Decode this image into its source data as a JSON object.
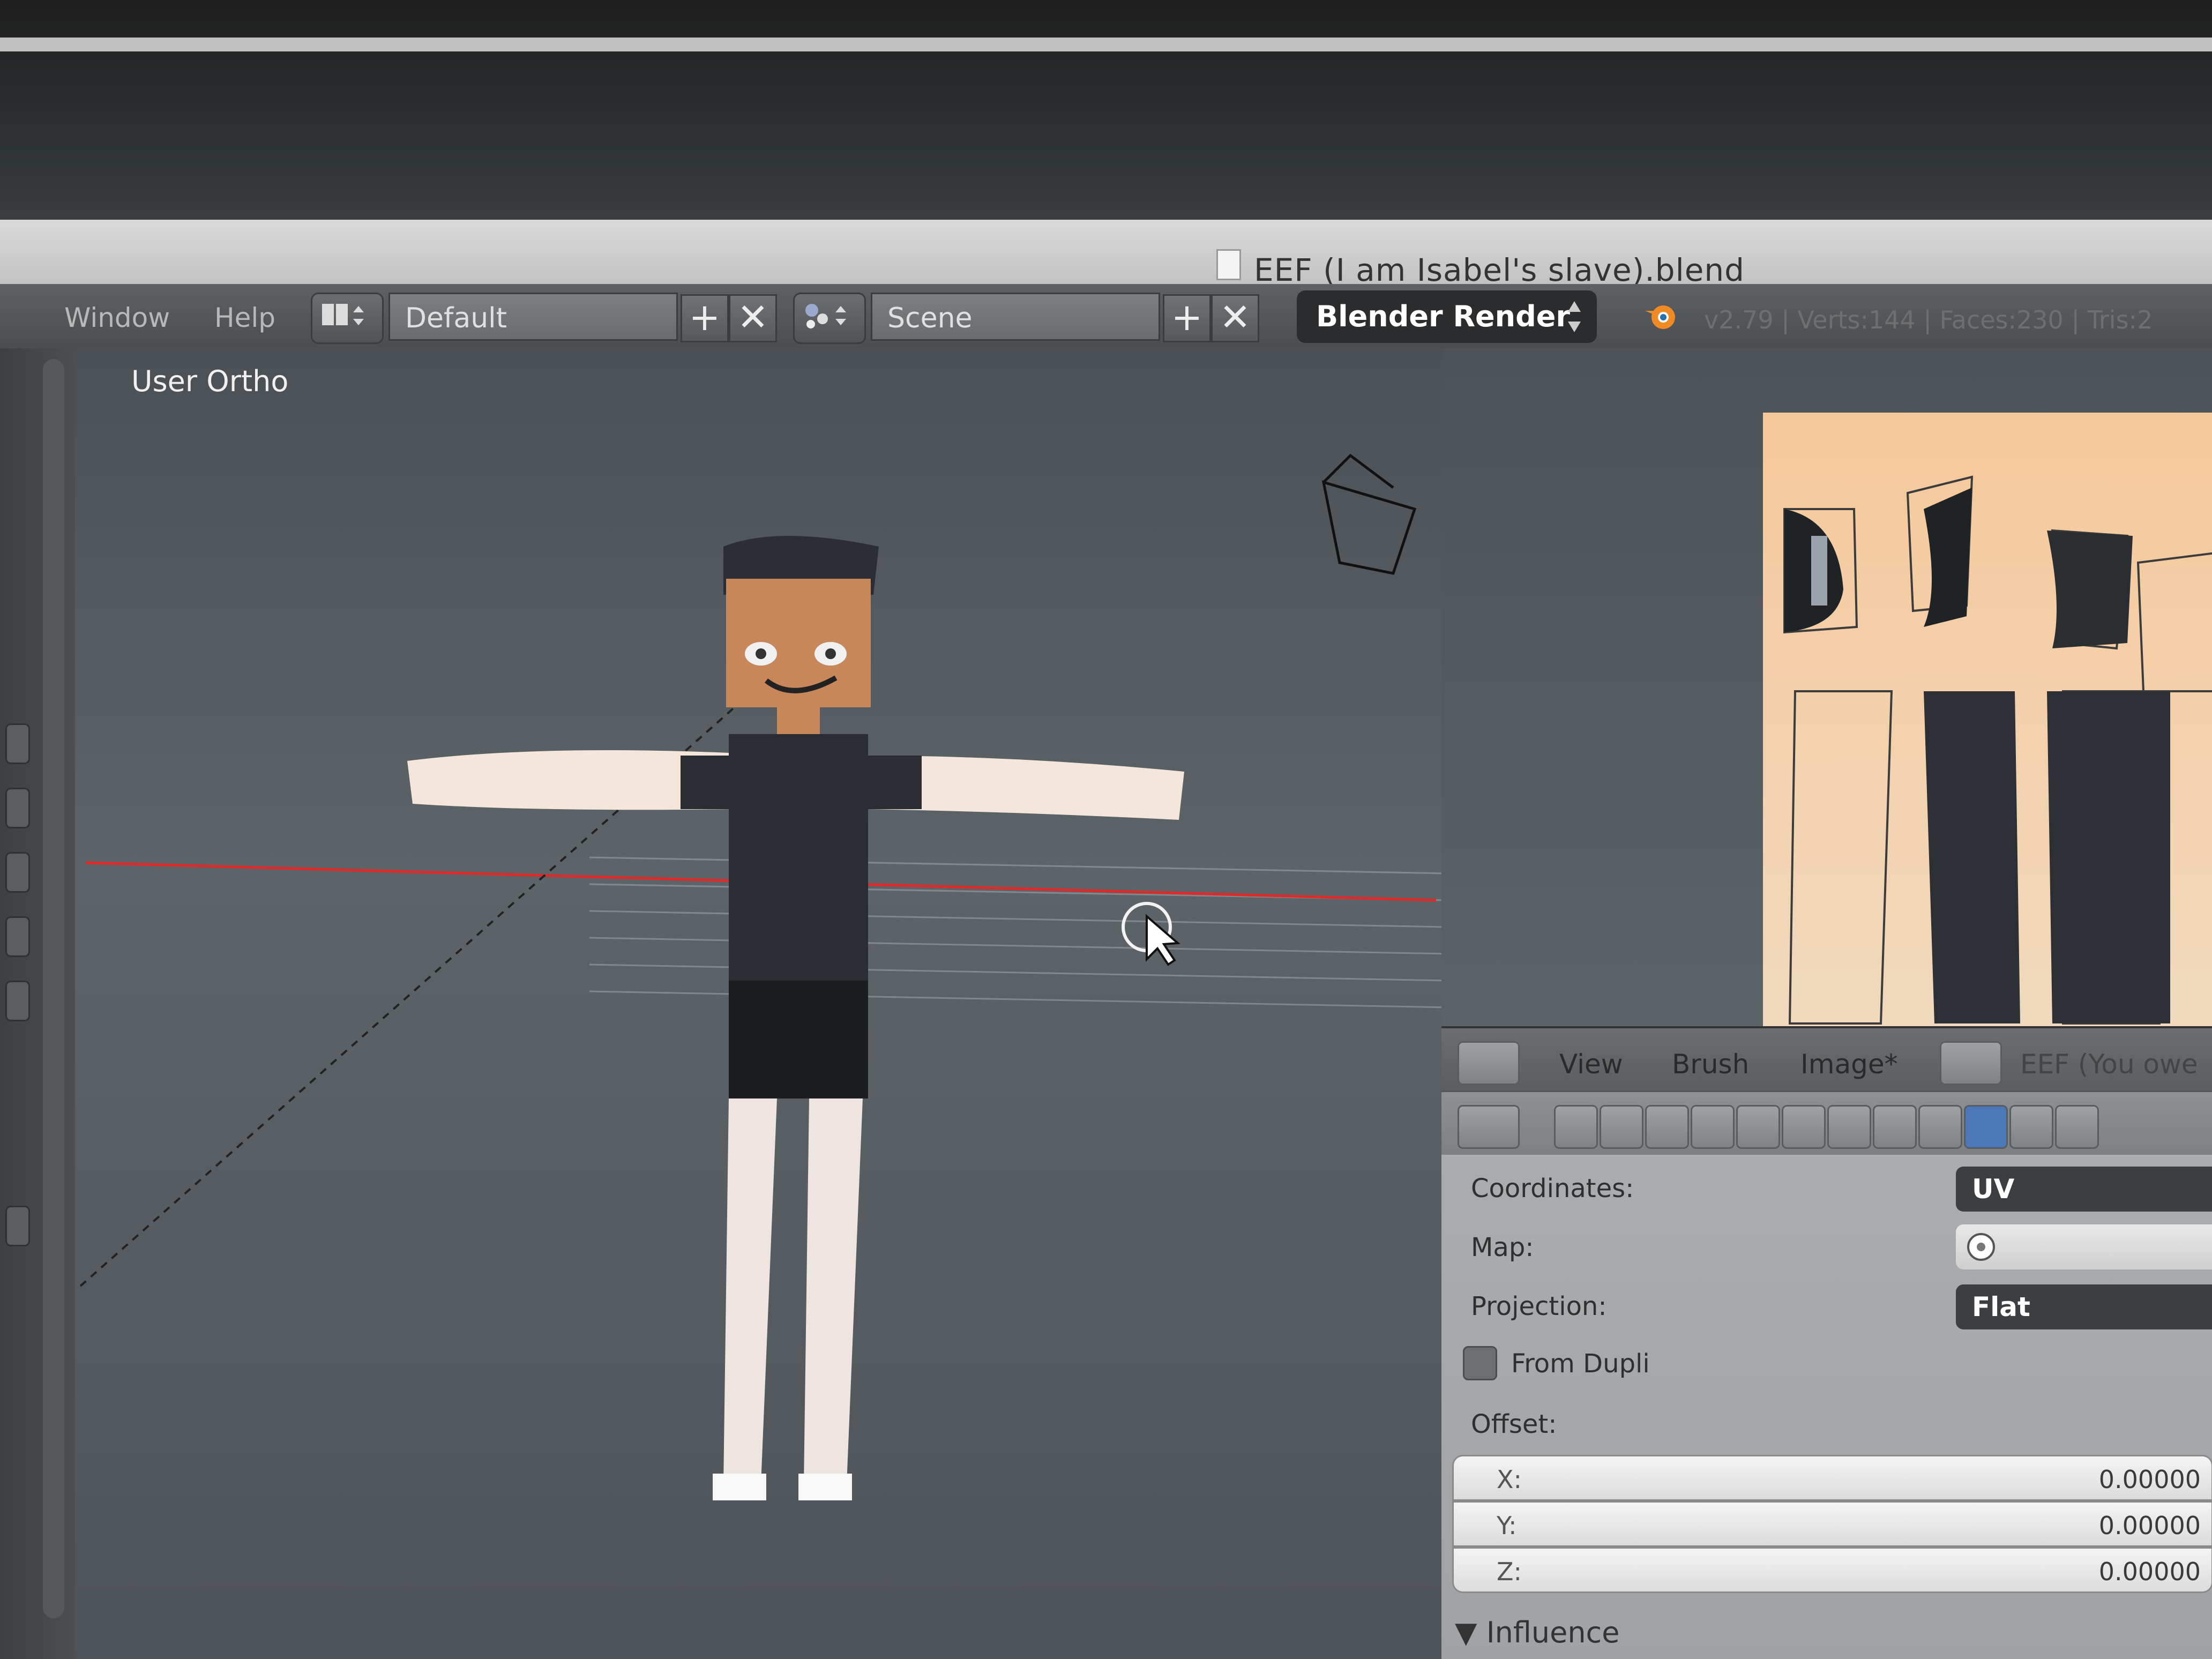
{
  "window": {
    "title": "EEF (I am Isabel's slave).blend"
  },
  "header": {
    "menus": [
      "Window",
      "Help"
    ],
    "screen_layout": "Default",
    "scene": "Scene",
    "render_engine": "Blender Render",
    "stats": "v2.79 | Verts:144 | Faces:230 | Tris:2"
  },
  "viewport": {
    "label": "User Ortho"
  },
  "uv_editor": {
    "menus": [
      "View",
      "Brush",
      "Image*"
    ],
    "image_name": "EEF (You owe"
  },
  "properties": {
    "coordinates_label": "Coordinates:",
    "coordinates_value": "UV",
    "map_label": "Map:",
    "projection_label": "Projection:",
    "projection_value": "Flat",
    "from_dupli_label": "From Dupli",
    "offset_label": "Offset:",
    "offset": [
      {
        "axis": "X:",
        "value": "0.00000"
      },
      {
        "axis": "Y:",
        "value": "0.00000"
      },
      {
        "axis": "Z:",
        "value": "0.00000"
      }
    ],
    "influence_label": "Influence"
  }
}
